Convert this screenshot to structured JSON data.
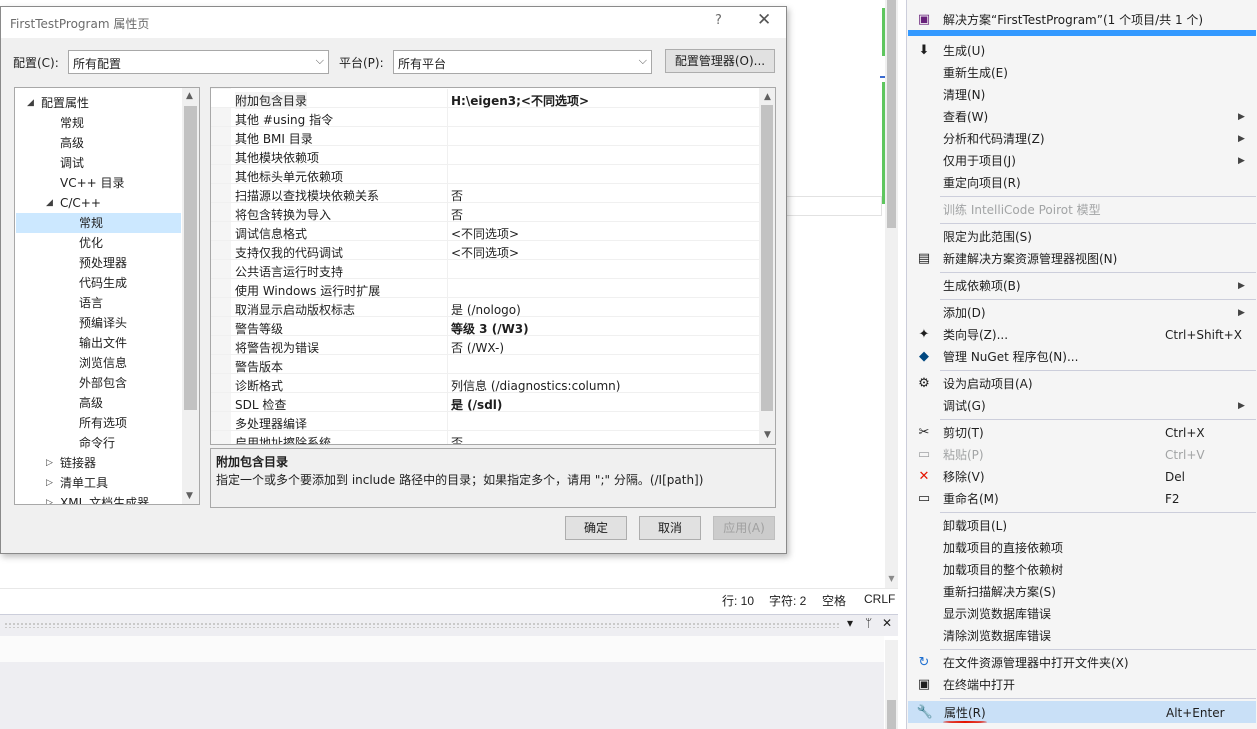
{
  "dialog": {
    "title": "FirstTestProgram 属性页",
    "help": "?",
    "close": "✕",
    "config_label": "配置(C):",
    "config_value": "所有配置",
    "platform_label": "平台(P):",
    "platform_value": "所有平台",
    "config_manager": "配置管理器(O)...",
    "ok": "确定",
    "cancel": "取消",
    "apply": "应用(A)"
  },
  "tree": [
    {
      "label": "配置属性",
      "level": 0,
      "expander": "◢"
    },
    {
      "label": "常规",
      "level": 1
    },
    {
      "label": "高级",
      "level": 1
    },
    {
      "label": "调试",
      "level": 1
    },
    {
      "label": "VC++ 目录",
      "level": 1
    },
    {
      "label": "C/C++",
      "level": 1,
      "expander": "◢"
    },
    {
      "label": "常规",
      "level": 2,
      "selected": true
    },
    {
      "label": "优化",
      "level": 2
    },
    {
      "label": "预处理器",
      "level": 2
    },
    {
      "label": "代码生成",
      "level": 2
    },
    {
      "label": "语言",
      "level": 2
    },
    {
      "label": "预编译头",
      "level": 2
    },
    {
      "label": "输出文件",
      "level": 2
    },
    {
      "label": "浏览信息",
      "level": 2
    },
    {
      "label": "外部包含",
      "level": 2
    },
    {
      "label": "高级",
      "level": 2
    },
    {
      "label": "所有选项",
      "level": 2
    },
    {
      "label": "命令行",
      "level": 2
    },
    {
      "label": "链接器",
      "level": 1,
      "expander": "▷"
    },
    {
      "label": "清单工具",
      "level": 1,
      "expander": "▷"
    },
    {
      "label": "XML 文档生成器",
      "level": 1,
      "expander": "▷"
    }
  ],
  "grid": [
    {
      "name": "附加包含目录",
      "value": "H:\\eigen3;<不同选项>",
      "bold": true
    },
    {
      "name": "其他 #using 指令",
      "value": ""
    },
    {
      "name": "其他 BMI 目录",
      "value": ""
    },
    {
      "name": "其他模块依赖项",
      "value": ""
    },
    {
      "name": "其他标头单元依赖项",
      "value": ""
    },
    {
      "name": "扫描源以查找模块依赖关系",
      "value": "否"
    },
    {
      "name": "将包含转换为导入",
      "value": "否"
    },
    {
      "name": "调试信息格式",
      "value": "<不同选项>"
    },
    {
      "name": "支持仅我的代码调试",
      "value": "<不同选项>"
    },
    {
      "name": "公共语言运行时支持",
      "value": ""
    },
    {
      "name": "使用 Windows 运行时扩展",
      "value": ""
    },
    {
      "name": "取消显示启动版权标志",
      "value": "是 (/nologo)"
    },
    {
      "name": "警告等级",
      "value": "等级 3 (/W3)",
      "bold": true
    },
    {
      "name": "将警告视为错误",
      "value": "否 (/WX-)"
    },
    {
      "name": "警告版本",
      "value": ""
    },
    {
      "name": "诊断格式",
      "value": "列信息 (/diagnostics:column)"
    },
    {
      "name": "SDL 检查",
      "value": "是 (/sdl)",
      "bold": true
    },
    {
      "name": "多处理器编译",
      "value": ""
    },
    {
      "name": "启用地址擦除系统",
      "value": "否"
    }
  ],
  "description": {
    "title": "附加包含目录",
    "text": "指定一个或多个要添加到 include 路径中的目录；如果指定多个，请用 \";\" 分隔。(/I[path])"
  },
  "status": {
    "line": "行: 10",
    "char": "字符: 2",
    "space": "空格",
    "eol": "CRLF"
  },
  "panel": {
    "dropdown": "▾",
    "pin": "ᛘ",
    "close": "✕"
  },
  "menu": {
    "solution_item": "解决方案“FirstTestProgram”(1 个项目/共 1 个)",
    "items": [
      {
        "label": "生成(U)",
        "icon": "build-icon"
      },
      {
        "label": "重新生成(E)"
      },
      {
        "label": "清理(N)"
      },
      {
        "label": "查看(W)",
        "sub": true
      },
      {
        "label": "分析和代码清理(Z)",
        "sub": true
      },
      {
        "label": "仅用于项目(J)",
        "sub": true
      },
      {
        "label": "重定向项目(R)"
      },
      {
        "sep": true
      },
      {
        "label": "训练 IntelliCode Poirot 模型",
        "disabled": true
      },
      {
        "sep": true
      },
      {
        "label": "限定为此范围(S)"
      },
      {
        "label": "新建解决方案资源管理器视图(N)",
        "icon": "new-view-icon"
      },
      {
        "sep": true
      },
      {
        "label": "生成依赖项(B)",
        "sub": true
      },
      {
        "sep": true
      },
      {
        "label": "添加(D)",
        "sub": true
      },
      {
        "label": "类向导(Z)...",
        "shortcut": "Ctrl+Shift+X",
        "icon": "class-wizard-icon"
      },
      {
        "label": "管理 NuGet 程序包(N)...",
        "icon": "nuget-icon"
      },
      {
        "sep": true
      },
      {
        "label": "设为启动项目(A)",
        "icon": "gear-icon"
      },
      {
        "label": "调试(G)",
        "sub": true
      },
      {
        "sep": true
      },
      {
        "label": "剪切(T)",
        "shortcut": "Ctrl+X",
        "icon": "cut-icon"
      },
      {
        "label": "粘贴(P)",
        "shortcut": "Ctrl+V",
        "disabled": true,
        "icon": "paste-icon"
      },
      {
        "label": "移除(V)",
        "shortcut": "Del",
        "icon": "remove-icon"
      },
      {
        "label": "重命名(M)",
        "shortcut": "F2",
        "icon": "rename-icon"
      },
      {
        "sep": true
      },
      {
        "label": "卸载项目(L)"
      },
      {
        "label": "加载项目的直接依赖项"
      },
      {
        "label": "加载项目的整个依赖树"
      },
      {
        "label": "重新扫描解决方案(S)"
      },
      {
        "label": "显示浏览数据库错误"
      },
      {
        "label": "清除浏览数据库错误"
      },
      {
        "sep": true
      },
      {
        "label": "在文件资源管理器中打开文件夹(X)",
        "icon": "open-folder-icon"
      },
      {
        "label": "在终端中打开",
        "icon": "terminal-icon"
      },
      {
        "sep": true
      },
      {
        "label": "属性(R)",
        "shortcut": "Alt+Enter",
        "icon": "wrench-icon",
        "highlighted": true
      }
    ]
  },
  "colors": {
    "accent": "#3399ff",
    "selection": "#cce8ff",
    "menu_highlight": "#c9e0f7",
    "remove_red": "#e51400",
    "underline_red": "#e51400",
    "git_green": "#5fc65f"
  }
}
